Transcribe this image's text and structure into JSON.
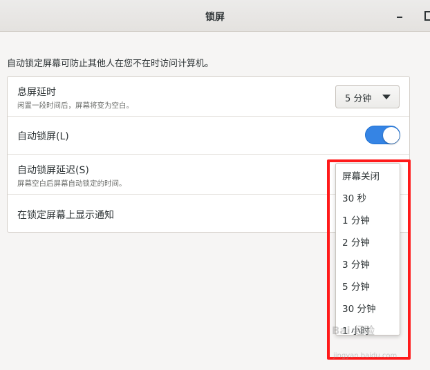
{
  "window": {
    "title": "锁屏"
  },
  "description": "自动锁定屏幕可防止其他人在您不在时访问计算机。",
  "settings": {
    "blank_screen": {
      "title": "息屏延时",
      "subtitle": "闲置一段时间后，屏幕将变为空白。",
      "value": "5 分钟"
    },
    "auto_lock": {
      "title": "自动锁屏(L)",
      "enabled": true
    },
    "lock_delay": {
      "title": "自动锁屏延迟(S)",
      "subtitle": "屏幕空白后屏幕自动锁定的时间。"
    },
    "show_notifications": {
      "title": "在锁定屏幕上显示通知"
    }
  },
  "dropdown": {
    "options": [
      "屏幕关闭",
      "30 秒",
      "1 分钟",
      "2 分钟",
      "3 分钟",
      "5 分钟",
      "30 分钟",
      "1 小时"
    ]
  },
  "colors": {
    "accent": "#3584e4",
    "highlight_box": "#ff1a1a"
  },
  "watermark": {
    "text": "Bai 经验",
    "url": "jingyan.baidu.com"
  }
}
